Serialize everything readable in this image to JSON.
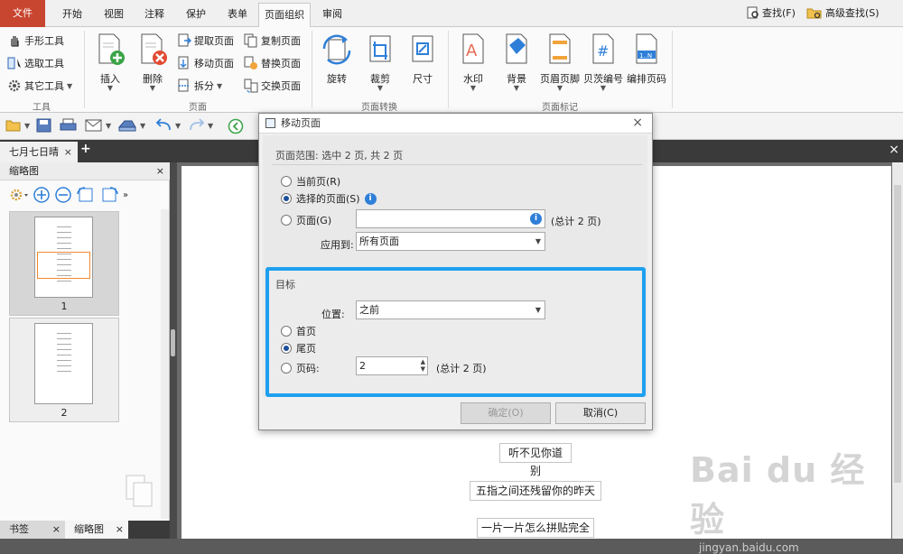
{
  "menu": {
    "file": "文件",
    "tabs": [
      "开始",
      "视图",
      "注释",
      "保护",
      "表单",
      "页面组织",
      "审阅"
    ],
    "active_tab": "页面组织",
    "search": "查找(F)",
    "advanced_search": "高级查找(S)"
  },
  "ribbon": {
    "tools": [
      "手形工具",
      "选取工具",
      "其它工具"
    ],
    "tools_group": "工具",
    "insert": "插入",
    "delete": "删除",
    "page_small": [
      "提取页面",
      "移动页面",
      "拆分",
      "复制页面",
      "替换页面",
      "交换页面"
    ],
    "page_group": "页面",
    "transform": [
      "旋转",
      "裁剪",
      "尺寸"
    ],
    "transform_group": "页面转换",
    "marks": [
      "水印",
      "背景",
      "页眉页脚",
      "贝茨编号",
      "编排页码"
    ],
    "marks_group": "页面标记"
  },
  "document_tab": "七月七日晴",
  "left_panel": {
    "title": "缩略图",
    "pages": [
      "1",
      "2"
    ],
    "bottom_tabs": [
      "书签",
      "缩略图"
    ]
  },
  "document": {
    "lines": [
      "听不见你道别",
      "五指之间还残留你的昨天",
      "一片一片怎么拼贴完全"
    ]
  },
  "watermark": {
    "text": "Bai du 经验",
    "url": "jingyan.baidu.com"
  },
  "dialog": {
    "title": "移动页面",
    "range_header": "页面范围: 选中 2 页, 共 2 页",
    "current_page": "当前页(R)",
    "selected_pages": "选择的页面(S)",
    "pages": "页面(G)",
    "pages_value": "",
    "pages_total": "(总计 2 页)",
    "apply_to_label": "应用到:",
    "apply_to_value": "所有页面",
    "target_header": "目标",
    "position_label": "位置:",
    "position_value": "之前",
    "first_page": "首页",
    "last_page": "尾页",
    "page_number": "页码:",
    "page_number_value": "2",
    "page_number_total": "(总计 2 页)",
    "ok": "确定(O)",
    "cancel": "取消(C)"
  },
  "colors": {
    "file_tab": "#c8452f",
    "highlight_box": "#1ea0f0",
    "accent_green": "#3aa346",
    "accent_red": "#e24a32",
    "accent_blue": "#2f7fd8"
  }
}
